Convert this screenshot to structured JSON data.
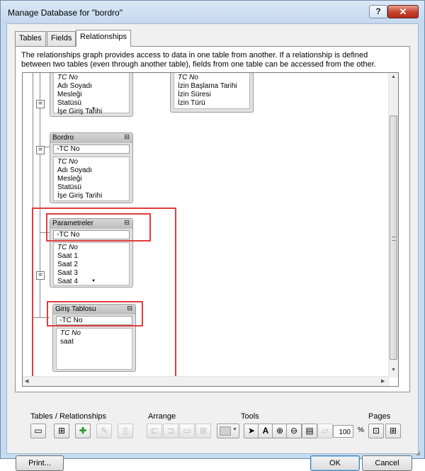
{
  "window": {
    "title": "Manage Database for \"bordro\"",
    "help_label": "?",
    "close_label": "✕"
  },
  "tabs": [
    {
      "label": "Tables",
      "active": false
    },
    {
      "label": "Fields",
      "active": false
    },
    {
      "label": "Relationships",
      "active": true
    }
  ],
  "description": "The relationships graph provides access to data in one table from another. If a relationship is defined between two tables (even through another table), fields from one table can be accessed from the other.",
  "graph": {
    "tables": [
      {
        "id": "top-left",
        "name": "",
        "key_field": "",
        "fields": [
          "TC No",
          "Adı Soyadı",
          "Mesleği",
          "Statüsü",
          "İşe Giriş Tarihi"
        ]
      },
      {
        "id": "top-right",
        "name": "",
        "key_field": "",
        "fields": [
          "TC No",
          "İzin Başlama Tarihi",
          "İzin Süresi",
          "İzin Türü"
        ]
      },
      {
        "id": "bordro",
        "name": "Bordro",
        "key_field": "TC No",
        "fields": [
          "TC No",
          "Adı Soyadı",
          "Mesleği",
          "Statüsü",
          "İşe Giriş Tarihi"
        ]
      },
      {
        "id": "parametreler",
        "name": "Parametreler",
        "key_field": "TC No",
        "fields": [
          "TC No",
          "Saat 1",
          "Saat 2",
          "Saat 3",
          "Saat 4"
        ]
      },
      {
        "id": "giris-tablosu",
        "name": "Giriş Tablosu",
        "key_field": "TC No",
        "fields": [
          "TC No",
          "saat"
        ]
      }
    ],
    "relation_symbol": "="
  },
  "toolbar": {
    "tables_relationships_label": "Tables / Relationships",
    "arrange_label": "Arrange",
    "tools_label": "Tools",
    "pages_label": "Pages",
    "zoom_value": "100",
    "zoom_unit": "%"
  },
  "buttons": {
    "print": "Print...",
    "ok": "OK",
    "cancel": "Cancel"
  }
}
